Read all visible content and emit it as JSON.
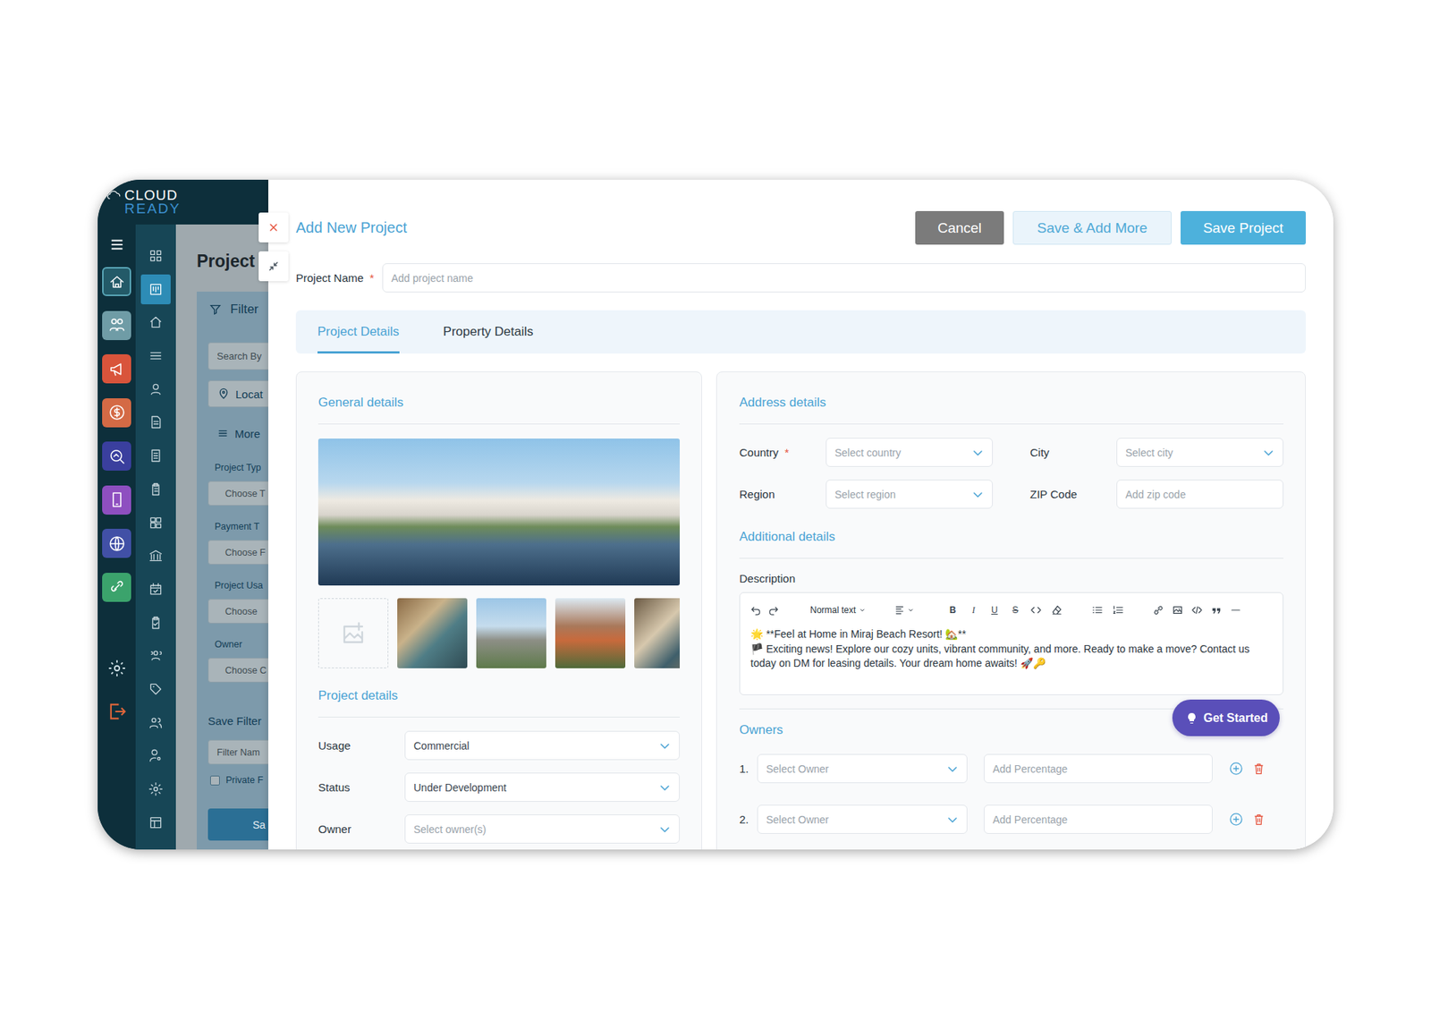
{
  "required_mark": "*",
  "app": {
    "logo": {
      "top": "CLOUD",
      "bottom": "READY"
    }
  },
  "sidebar": {
    "modules": [
      {
        "color": "#235a68",
        "selected": true
      },
      {
        "color": "#6f9ca6",
        "selected": false
      },
      {
        "color": "#d9543b",
        "selected": false
      },
      {
        "color": "#d46a45",
        "selected": false
      },
      {
        "color": "#3a3f9e",
        "selected": false
      },
      {
        "color": "#8e4fc0",
        "selected": false
      },
      {
        "color": "#4150a6",
        "selected": false
      },
      {
        "color": "#3ba36c",
        "selected": false
      }
    ],
    "nav": [
      {
        "selected": false
      },
      {
        "selected": true
      },
      {
        "selected": false
      },
      {
        "selected": false
      },
      {
        "selected": false
      },
      {
        "selected": false
      },
      {
        "selected": false
      },
      {
        "selected": false
      },
      {
        "selected": false
      },
      {
        "selected": false
      },
      {
        "selected": false
      },
      {
        "selected": false
      },
      {
        "selected": false
      },
      {
        "selected": false
      },
      {
        "selected": false
      },
      {
        "selected": false
      },
      {
        "selected": false
      },
      {
        "selected": false
      }
    ]
  },
  "background_page": {
    "title": "Project",
    "filter": {
      "title": "Filter",
      "search": "Search By",
      "location": "Locat",
      "more": "More",
      "groups": [
        {
          "label": "Project Typ",
          "placeholder": "Choose T"
        },
        {
          "label": "Payment T",
          "placeholder": "Choose F"
        },
        {
          "label": "Project Usa",
          "placeholder": "Choose"
        },
        {
          "label": "Owner",
          "placeholder": "Choose C"
        }
      ]
    },
    "save_filter": {
      "title": "Save Filter",
      "placeholder": "Filter Nam",
      "private": "Private F",
      "private_checked": false,
      "button": "Sa"
    }
  },
  "dialog": {
    "title": "Add New Project",
    "buttons": [
      {
        "label": "Cancel",
        "kind": "neutral"
      },
      {
        "label": "Save & Add More",
        "kind": "secondary"
      },
      {
        "label": "Save Project",
        "kind": "primary"
      }
    ],
    "project_name": {
      "label": "Project Name",
      "required": true,
      "placeholder": "Add project name"
    },
    "tabs": [
      {
        "label": "Project Details",
        "selected": true
      },
      {
        "label": "Property Details",
        "selected": false
      }
    ],
    "general": {
      "title": "General details",
      "thumbnails": [
        {
          "kind": "upload"
        },
        {
          "kind": "photo"
        },
        {
          "kind": "photo"
        },
        {
          "kind": "photo"
        },
        {
          "kind": "photo"
        }
      ]
    },
    "project_details": {
      "title": "Project details",
      "fields": [
        {
          "label": "Usage",
          "text": "Commercial",
          "filled": true
        },
        {
          "label": "Status",
          "text": "Under Development",
          "filled": true
        },
        {
          "label": "Owner",
          "text": "Select owner(s)",
          "filled": false
        }
      ]
    },
    "address": {
      "title": "Address details",
      "fields": [
        {
          "label": "Country",
          "required": true,
          "kind": "select",
          "text": "Select country"
        },
        {
          "label": "City",
          "required": false,
          "kind": "select",
          "text": "Select city"
        },
        {
          "label": "Region",
          "required": false,
          "kind": "select",
          "text": "Select region"
        },
        {
          "label": "ZIP Code",
          "required": false,
          "kind": "input",
          "text": "Add zip code"
        }
      ]
    },
    "additional": {
      "title": "Additional details",
      "description": {
        "label": "Description",
        "format": "Normal text",
        "marks": [
          "B",
          "I",
          "U",
          "S"
        ],
        "lines": [
          "🌟 **Feel at Home in Miraj Beach Resort! 🏡**",
          "🏴 Exciting news! Explore our cozy units, vibrant community, and more. Ready to make a move? Contact us today on DM for leasing details. Your dream home awaits! 🚀🔑"
        ]
      }
    },
    "owners": {
      "title": "Owners",
      "rows": [
        {
          "index": "1.",
          "select": "Select Owner",
          "percent": "Add Percentage"
        },
        {
          "index": "2.",
          "select": "Select Owner",
          "percent": "Add Percentage"
        }
      ]
    },
    "assistant": {
      "label": "Get Started"
    }
  }
}
